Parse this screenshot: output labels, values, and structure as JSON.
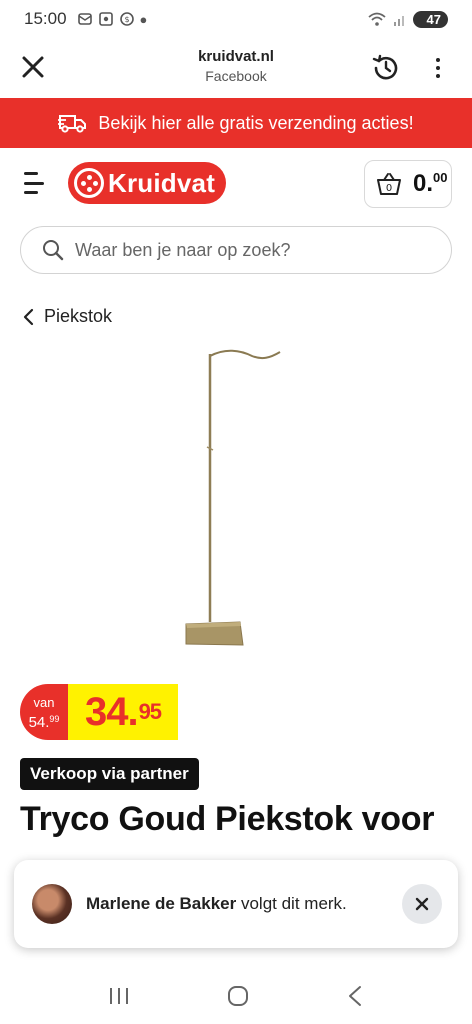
{
  "status_bar": {
    "time": "15:00",
    "battery": "47"
  },
  "browser": {
    "domain": "kruidvat.nl",
    "source": "Facebook"
  },
  "promo": {
    "text": "Bekijk hier alle gratis verzending acties!"
  },
  "header": {
    "logo_text": "Kruidvat",
    "cart_count": "0",
    "cart_price_main": "0.",
    "cart_price_cents": "00"
  },
  "search": {
    "placeholder": "Waar ben je naar op zoek?"
  },
  "breadcrumb": {
    "label": "Piekstok"
  },
  "price": {
    "old_label": "van",
    "old_main": "54.",
    "old_cents": "99",
    "new_main": "34.",
    "new_cents": "95"
  },
  "badge": {
    "text": "Verkoop via partner"
  },
  "product": {
    "title": "Tryco Goud Piekstok voor"
  },
  "toast": {
    "name": "Marlene de Bakker",
    "message": " volgt dit merk."
  },
  "colors": {
    "brand_red": "#e8302a",
    "price_yellow": "#fff200"
  }
}
